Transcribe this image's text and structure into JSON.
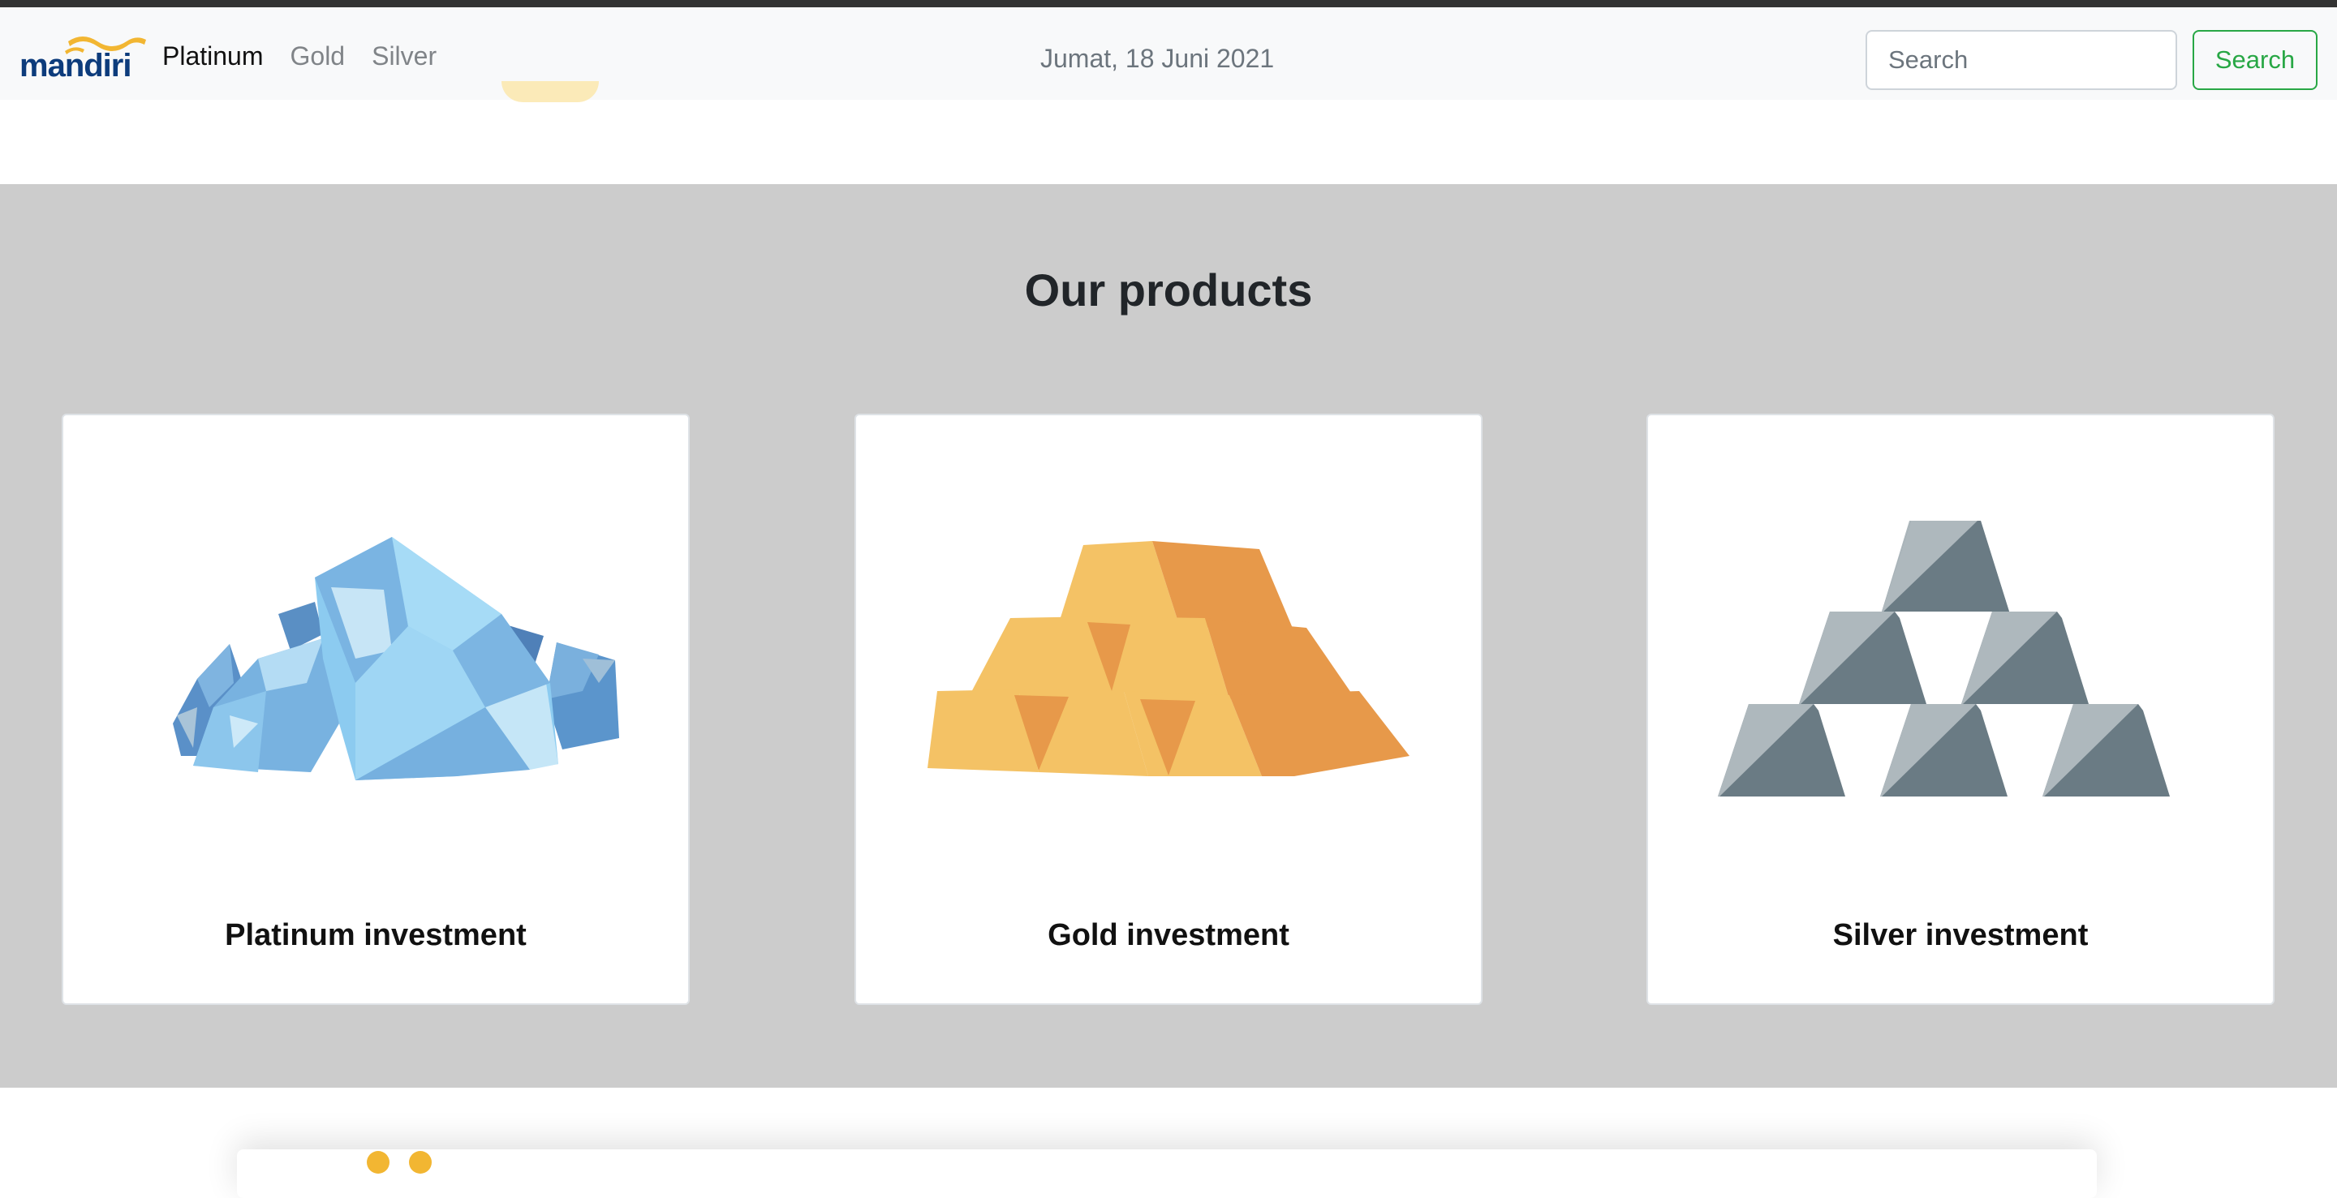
{
  "navbar": {
    "brand": {
      "text": "mandiri",
      "icon": "mandiri-wave-logo"
    },
    "links": [
      {
        "label": "Platinum",
        "active": true
      },
      {
        "label": "Gold",
        "active": false
      },
      {
        "label": "Silver",
        "active": false
      }
    ],
    "date": "Jumat, 18 Juni 2021",
    "search": {
      "placeholder": "Search",
      "button_label": "Search"
    }
  },
  "products": {
    "title": "Our products",
    "cards": [
      {
        "title": "Platinum investment",
        "icon": "platinum-crystals-icon"
      },
      {
        "title": "Gold investment",
        "icon": "gold-bars-icon"
      },
      {
        "title": "Silver investment",
        "icon": "silver-bars-icon"
      }
    ]
  },
  "colors": {
    "navbar_bg": "#f8f9fa",
    "section_bg": "#cccccc",
    "search_button": "#28a745",
    "brand_text": "#0d3c7c",
    "brand_wave": "#f2b632"
  }
}
